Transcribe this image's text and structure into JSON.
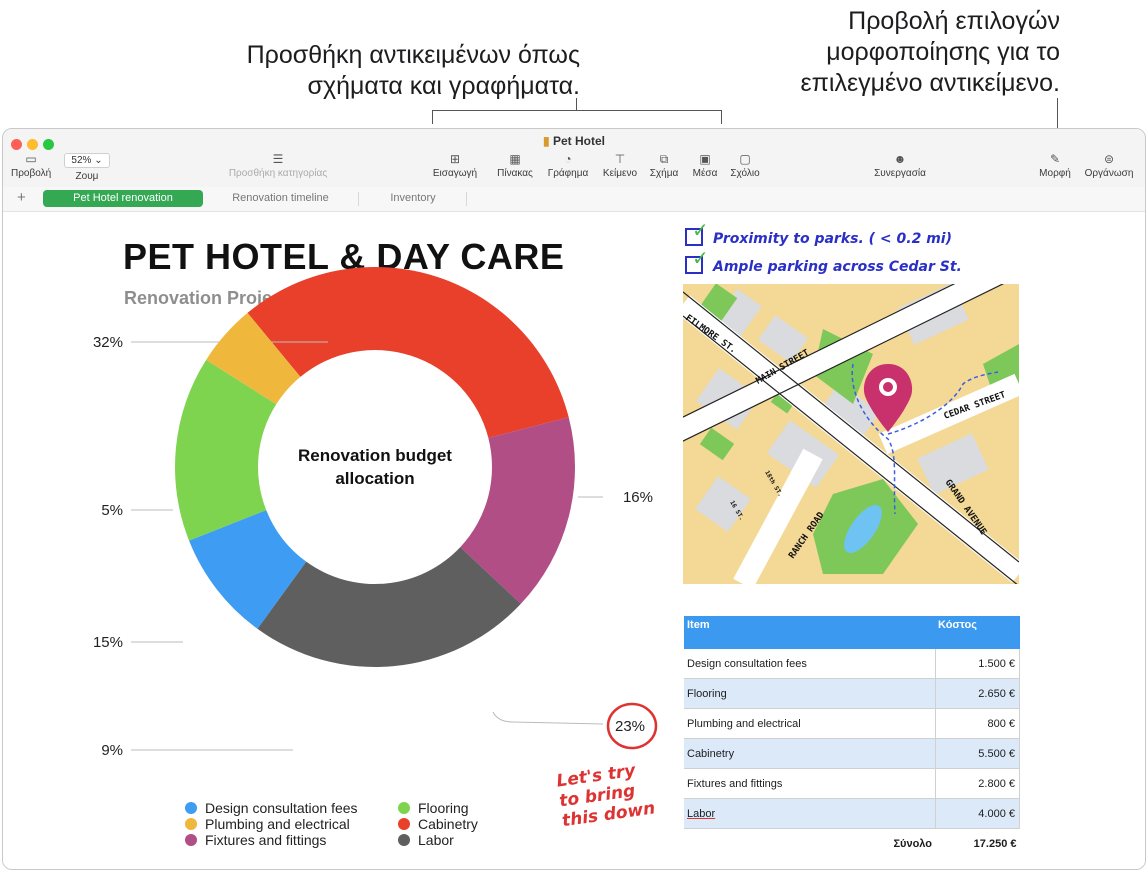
{
  "callouts": {
    "insert_line1": "Προσθήκη αντικειμένων όπως",
    "insert_line2": "σχήματα και γραφήματα.",
    "format_line1": "Προβολή επιλογών",
    "format_line2": "μορφοποίησης για το",
    "format_line3": "επιλεγμένο αντικείμενο."
  },
  "window": {
    "title": "Pet Hotel"
  },
  "toolbar": {
    "view": "Προβολή",
    "zoom_value": "52%",
    "zoom": "Ζουμ",
    "add_category": "Προσθήκη κατηγορίας",
    "insert": "Εισαγωγή",
    "table": "Πίνακας",
    "chart": "Γράφημα",
    "text": "Κείμενο",
    "shape": "Σχήμα",
    "media": "Μέσα",
    "comment": "Σχόλιο",
    "collaborate": "Συνεργασία",
    "format": "Μορφή",
    "organize": "Οργάνωση"
  },
  "sheets": [
    "Pet Hotel renovation",
    "Renovation timeline",
    "Inventory"
  ],
  "doc": {
    "title": "PET HOTEL & DAY CARE",
    "subtitle": "Renovation Project – November 2020"
  },
  "chart_data": {
    "type": "pie",
    "title": "Renovation budget allocation",
    "donut": true,
    "categories": [
      "Cabinetry",
      "Fixtures and fittings",
      "Labor",
      "Design consultation fees",
      "Flooring",
      "Plumbing and electrical"
    ],
    "values": [
      32,
      16,
      23,
      9,
      15,
      5
    ],
    "value_labels": [
      "32%",
      "16%",
      "23%",
      "9%",
      "15%",
      "5%"
    ],
    "colors": [
      "#e8402a",
      "#b14e86",
      "#5f5f5f",
      "#3e9cf3",
      "#7ed44f",
      "#efb83d"
    ],
    "legend": [
      {
        "label": "Design consultation fees",
        "color": "#3e9cf3"
      },
      {
        "label": "Plumbing and electrical",
        "color": "#efb83d"
      },
      {
        "label": "Fixtures and fittings",
        "color": "#b14e86"
      },
      {
        "label": "Flooring",
        "color": "#7ed44f"
      },
      {
        "label": "Cabinetry",
        "color": "#e8402a"
      },
      {
        "label": "Labor",
        "color": "#5f5f5f"
      }
    ]
  },
  "checklist": [
    "Proximity to parks. ( < 0.2 mi)",
    "Ample parking across Cedar St."
  ],
  "map": {
    "streets": [
      "FILMORE ST.",
      "MAIN STREET",
      "CEDAR STREET",
      "RANCH ROAD",
      "GRAND AVENUE",
      "18th ST.",
      "16 ST."
    ]
  },
  "cost_table": {
    "headers": [
      "Item",
      "Κόστος"
    ],
    "rows": [
      [
        "Design consultation fees",
        "1.500 €"
      ],
      [
        "Flooring",
        "2.650 €"
      ],
      [
        "Plumbing and electrical",
        "800 €"
      ],
      [
        "Cabinetry",
        "5.500 €"
      ],
      [
        "Fixtures and fittings",
        "2.800 €"
      ],
      [
        "Labor",
        "4.000 €"
      ]
    ],
    "total_label": "Σύνολο",
    "total_value": "17.250 €"
  },
  "annotation": {
    "circled": "23%",
    "note_line1": "Let's try",
    "note_line2": "to bring",
    "note_line3": "this down"
  }
}
